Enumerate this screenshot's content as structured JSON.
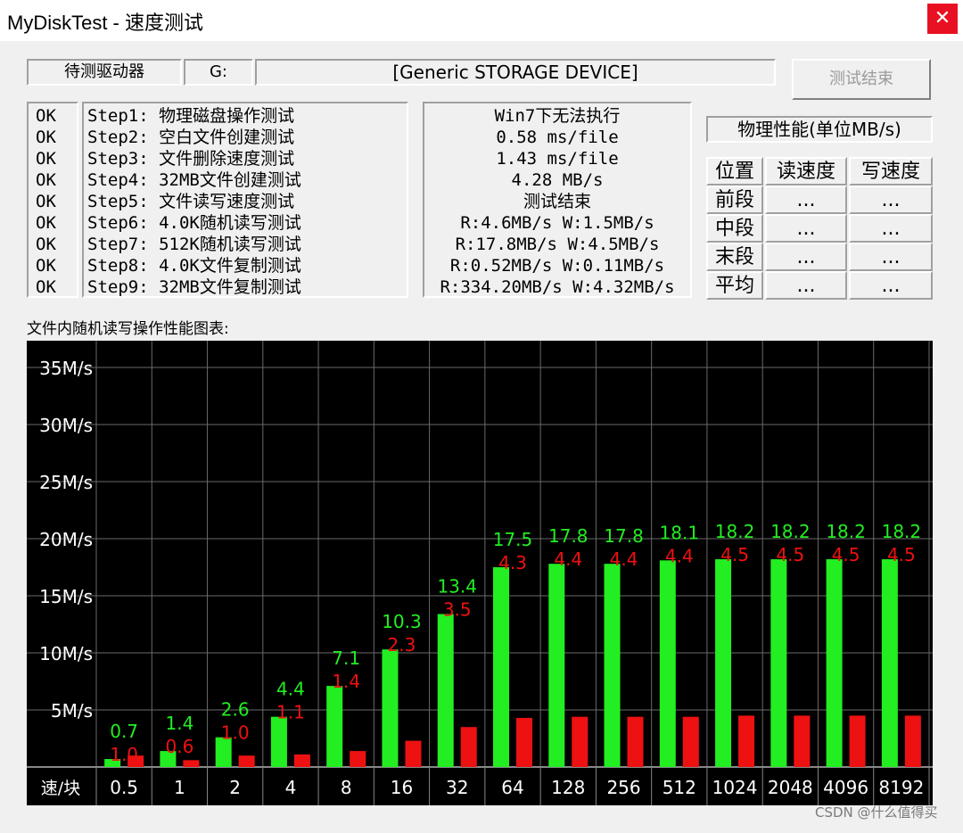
{
  "window": {
    "title": "MyDiskTest - 速度测试",
    "close_glyph": "✕"
  },
  "drive": {
    "label": "待测驱动器",
    "letter": "G:",
    "name": "[Generic STORAGE DEVICE]"
  },
  "finish_button": "测试结束",
  "steps": {
    "status": [
      "OK",
      "OK",
      "OK",
      "OK",
      "OK",
      "OK",
      "OK",
      "OK",
      "OK"
    ],
    "names": [
      "Step1: 物理磁盘操作测试",
      "Step2: 空白文件创建测试",
      "Step3: 文件删除速度测试",
      "Step4: 32MB文件创建测试",
      "Step5: 文件读写速度测试",
      "Step6: 4.0K随机读写测试",
      "Step7: 512K随机读写测试",
      "Step8: 4.0K文件复制测试",
      "Step9: 32MB文件复制测试"
    ],
    "results": [
      "Win7下无法执行",
      "0.58 ms/file",
      "1.43 ms/file",
      "4.28 MB/s",
      "测试结束",
      "R:4.6MB/s W:1.5MB/s",
      "R:17.8MB/s W:4.5MB/s",
      "R:0.52MB/s W:0.11MB/s",
      "R:334.20MB/s W:4.32MB/s"
    ]
  },
  "physical": {
    "title": "物理性能(单位MB/s)",
    "headers": [
      "位置",
      "读速度",
      "写速度"
    ],
    "rows": [
      {
        "pos": "前段",
        "read": "...",
        "write": "..."
      },
      {
        "pos": "中段",
        "read": "...",
        "write": "..."
      },
      {
        "pos": "末段",
        "read": "...",
        "write": "..."
      },
      {
        "pos": "平均",
        "read": "...",
        "write": "..."
      }
    ]
  },
  "chart_label": "文件内随机读写操作性能图表:",
  "colors": {
    "read": "#22ee22",
    "write": "#ee1111",
    "grid": "#6a6a6a",
    "bg": "#000000",
    "axis_text": "#ffffff"
  },
  "chart_data": {
    "type": "bar",
    "xlabel": "速/块",
    "categories": [
      "0.5",
      "1",
      "2",
      "4",
      "8",
      "16",
      "32",
      "64",
      "128",
      "256",
      "512",
      "1024",
      "2048",
      "4096",
      "8192"
    ],
    "yticks": [
      "5M/s",
      "10M/s",
      "15M/s",
      "20M/s",
      "25M/s",
      "30M/s",
      "35M/s"
    ],
    "ylim": [
      0,
      35
    ],
    "grid": true,
    "series": [
      {
        "values": [
          0.7,
          1.4,
          2.6,
          4.4,
          7.1,
          10.3,
          13.4,
          17.5,
          17.8,
          17.8,
          18.1,
          18.2,
          18.2,
          18.2,
          18.2
        ],
        "labels": [
          "0.7",
          "1.4",
          "2.6",
          "4.4",
          "7.1",
          "10.3",
          "13.4",
          "17.5",
          "17.8",
          "17.8",
          "18.1",
          "18.2",
          "18.2",
          "18.2",
          "18.2"
        ]
      },
      {
        "values": [
          1.0,
          0.6,
          1.0,
          1.1,
          1.4,
          2.3,
          3.5,
          4.3,
          4.4,
          4.4,
          4.4,
          4.5,
          4.5,
          4.5,
          4.5
        ],
        "labels": [
          "1.0",
          "0.6",
          "1.0",
          "1.1",
          "1.4",
          "2.3",
          "3.5",
          "4.3",
          "4.4",
          "4.4",
          "4.4",
          "4.5",
          "4.5",
          "4.5",
          "4.5"
        ]
      }
    ]
  },
  "watermark": "CSDN @什么值得买"
}
